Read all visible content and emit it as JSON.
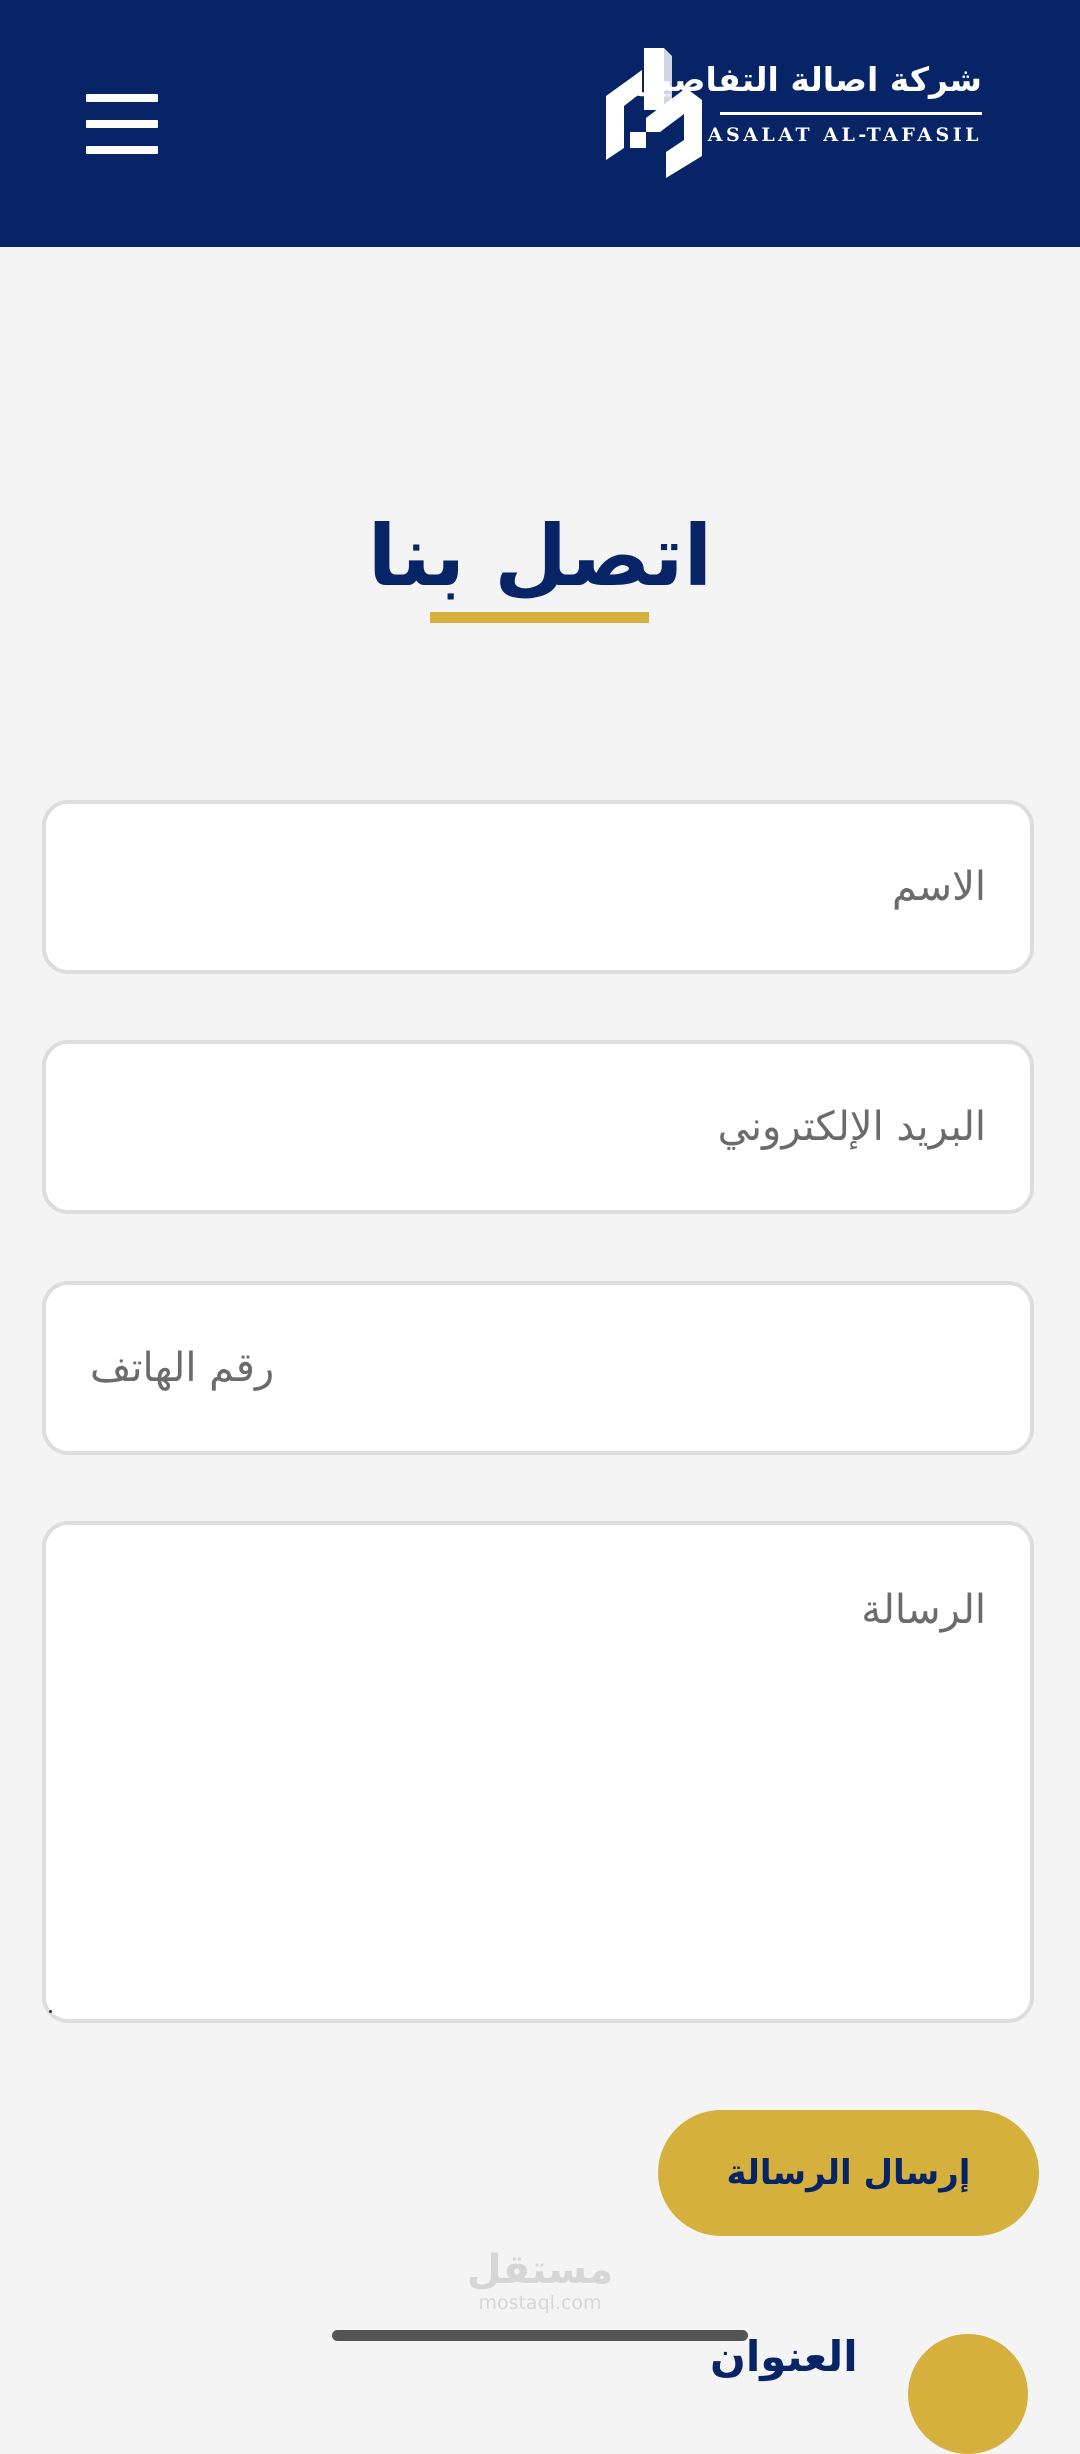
{
  "header": {
    "menu_icon": "hamburger-menu-icon",
    "logo": {
      "name_ar": "شركة اصالة التفاصيل",
      "name_en": "ASALAT AL-TAFASIL"
    },
    "background_color": "#062466"
  },
  "page": {
    "title": "اتصل بنا",
    "accent_color": "#d5b03d"
  },
  "form": {
    "name_placeholder": "الاسم",
    "email_placeholder": "البريد الإلكتروني",
    "phone_placeholder": "رقم الهاتف",
    "message_placeholder": "الرسالة",
    "submit_label": "إرسال الرسالة"
  },
  "watermark": {
    "text_ar": "مستقل",
    "text_en": "mostaql.com"
  },
  "next_section": {
    "heading": "العنوان"
  }
}
